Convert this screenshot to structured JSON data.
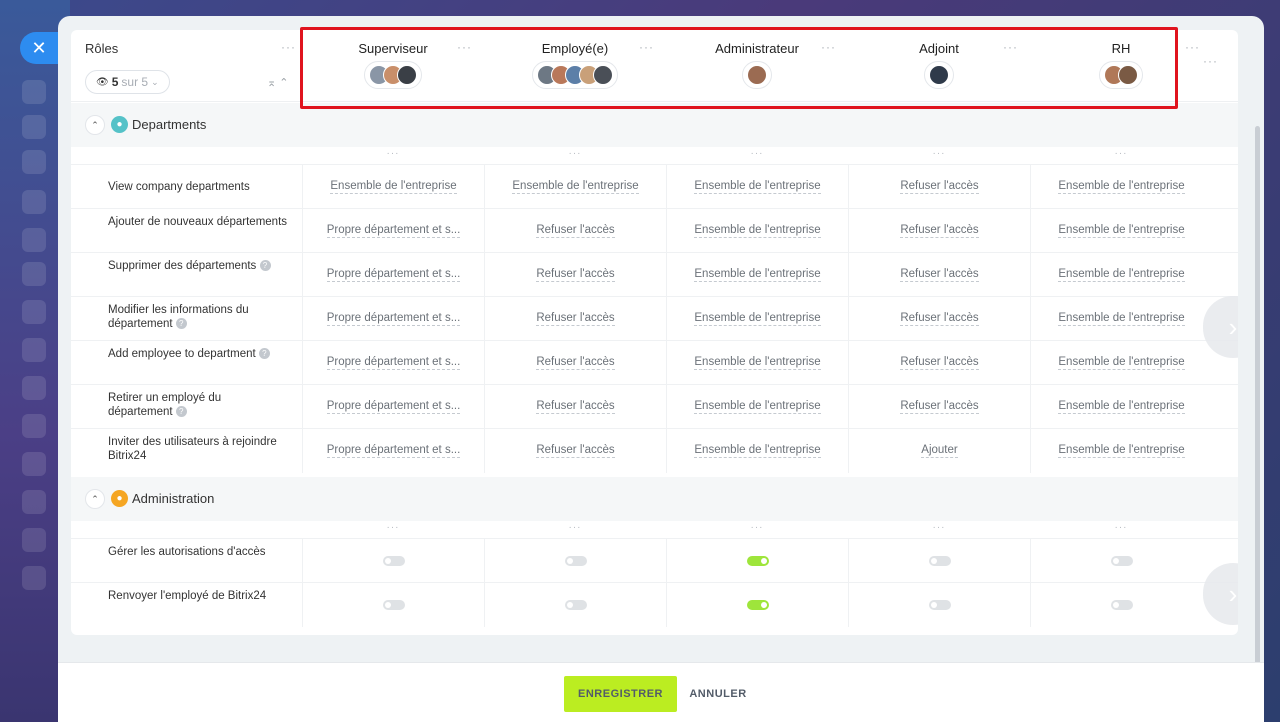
{
  "header": {
    "roles_title": "Rôles",
    "count_current": "5",
    "count_total": "sur 5"
  },
  "roles": [
    {
      "name": "Superviseur",
      "avatars": [
        "#8a96a6",
        "#c98f6a",
        "#3a3f46"
      ]
    },
    {
      "name": "Employé(e)",
      "avatars": [
        "#6d7884",
        "#b9785a",
        "#5c7fa8",
        "#c9a079",
        "#4a4f57"
      ]
    },
    {
      "name": "Administrateur",
      "avatars": [
        "#9b6b52"
      ]
    },
    {
      "name": "Adjoint",
      "avatars": [
        "#2f3a4a"
      ]
    },
    {
      "name": "RH",
      "avatars": [
        "#b07858",
        "#7a5a44"
      ]
    }
  ],
  "sections": [
    {
      "title": "Departments",
      "icon_color": "#55c2c8",
      "rows": [
        {
          "label": "View company departments",
          "help": false,
          "values": [
            "Ensemble de l'entreprise",
            "Ensemble de l'entreprise",
            "Ensemble de l'entreprise",
            "Refuser l'accès",
            "Ensemble de l'entreprise"
          ]
        },
        {
          "label": "Ajouter de nouveaux départements",
          "help": false,
          "values": [
            "Propre département et s...",
            "Refuser l'accès",
            "Ensemble de l'entreprise",
            "Refuser l'accès",
            "Ensemble de l'entreprise"
          ]
        },
        {
          "label": "Supprimer des départements",
          "help": true,
          "values": [
            "Propre département et s...",
            "Refuser l'accès",
            "Ensemble de l'entreprise",
            "Refuser l'accès",
            "Ensemble de l'entreprise"
          ]
        },
        {
          "label": "Modifier les informations du département",
          "help": true,
          "values": [
            "Propre département et s...",
            "Refuser l'accès",
            "Ensemble de l'entreprise",
            "Refuser l'accès",
            "Ensemble de l'entreprise"
          ]
        },
        {
          "label": "Add employee to department",
          "help": true,
          "values": [
            "Propre département et s...",
            "Refuser l'accès",
            "Ensemble de l'entreprise",
            "Refuser l'accès",
            "Ensemble de l'entreprise"
          ]
        },
        {
          "label": "Retirer un employé du département",
          "help": true,
          "values": [
            "Propre département et s...",
            "Refuser l'accès",
            "Ensemble de l'entreprise",
            "Refuser l'accès",
            "Ensemble de l'entreprise"
          ]
        },
        {
          "label": "Inviter des utilisateurs à rejoindre Bitrix24",
          "help": false,
          "values": [
            "Propre département et s...",
            "Refuser l'accès",
            "Ensemble de l'entreprise",
            "Ajouter",
            "Ensemble de l'entreprise"
          ]
        }
      ]
    },
    {
      "title": "Administration",
      "icon_color": "#f5a623",
      "rows": [
        {
          "label": "Gérer les autorisations d'accès",
          "help": false,
          "toggles": [
            false,
            false,
            true,
            false,
            false
          ]
        },
        {
          "label": "Renvoyer l'employé de Bitrix24",
          "help": false,
          "toggles": [
            false,
            false,
            true,
            false,
            false
          ]
        }
      ]
    }
  ],
  "footer": {
    "save_label": "ENREGISTRER",
    "cancel_label": "ANNULER"
  },
  "colors": {
    "accent_save": "#bbed21",
    "toggle_on": "#9ee53b",
    "highlight": "#e0141e"
  }
}
